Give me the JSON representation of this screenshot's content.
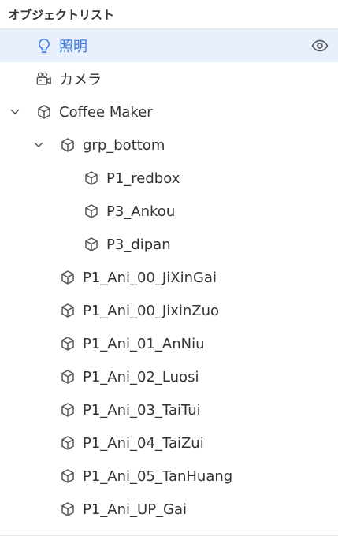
{
  "panel": {
    "title": "オブジェクトリスト"
  },
  "tree": {
    "items": [
      {
        "label": "照明",
        "icon": "lightbulb-icon",
        "depth": 0,
        "expandable": false,
        "selected": true,
        "visibility_icon": "eye-icon"
      },
      {
        "label": "カメラ",
        "icon": "camera-icon",
        "depth": 0,
        "expandable": false,
        "selected": false
      },
      {
        "label": "Coffee Maker",
        "icon": "cube-icon",
        "depth": 0,
        "expandable": true,
        "expanded": true,
        "selected": false
      },
      {
        "label": "grp_bottom",
        "icon": "cube-icon",
        "depth": 1,
        "expandable": true,
        "expanded": true,
        "selected": false
      },
      {
        "label": "P1_redbox",
        "icon": "cube-icon",
        "depth": 2,
        "expandable": false,
        "selected": false
      },
      {
        "label": "P3_Ankou",
        "icon": "cube-icon",
        "depth": 2,
        "expandable": false,
        "selected": false
      },
      {
        "label": "P3_dipan",
        "icon": "cube-icon",
        "depth": 2,
        "expandable": false,
        "selected": false
      },
      {
        "label": "P1_Ani_00_JiXinGai",
        "icon": "cube-icon",
        "depth": 1,
        "expandable": false,
        "selected": false
      },
      {
        "label": "P1_Ani_00_JixinZuo",
        "icon": "cube-icon",
        "depth": 1,
        "expandable": false,
        "selected": false
      },
      {
        "label": "P1_Ani_01_AnNiu",
        "icon": "cube-icon",
        "depth": 1,
        "expandable": false,
        "selected": false
      },
      {
        "label": "P1_Ani_02_Luosi",
        "icon": "cube-icon",
        "depth": 1,
        "expandable": false,
        "selected": false
      },
      {
        "label": "P1_Ani_03_TaiTui",
        "icon": "cube-icon",
        "depth": 1,
        "expandable": false,
        "selected": false
      },
      {
        "label": "P1_Ani_04_TaiZui",
        "icon": "cube-icon",
        "depth": 1,
        "expandable": false,
        "selected": false
      },
      {
        "label": "P1_Ani_05_TanHuang",
        "icon": "cube-icon",
        "depth": 1,
        "expandable": false,
        "selected": false
      },
      {
        "label": "P1_Ani_UP_Gai",
        "icon": "cube-icon",
        "depth": 1,
        "expandable": false,
        "selected": false
      }
    ]
  },
  "colors": {
    "accent": "#3a79e0",
    "selected_bg": "#e8f0fe",
    "text": "#333333",
    "icon": "#555555"
  }
}
